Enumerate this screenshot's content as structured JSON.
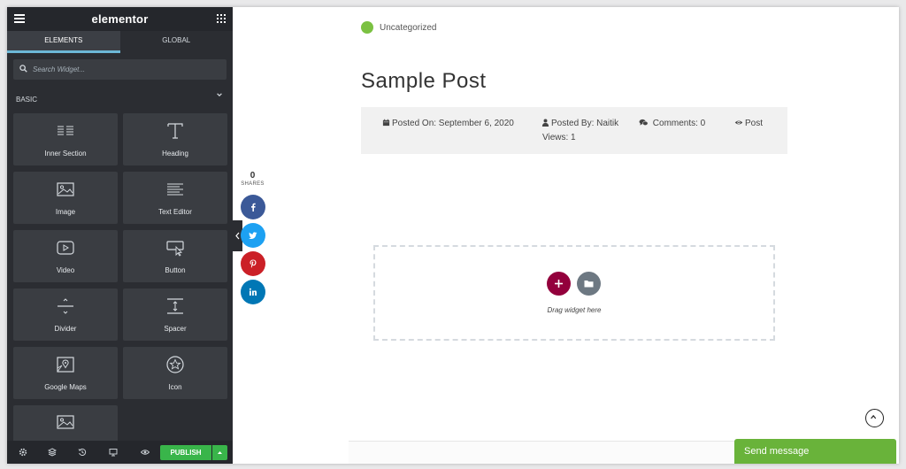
{
  "app": {
    "logo": "elementor"
  },
  "sidebar": {
    "tabs": [
      {
        "label": "ELEMENTS",
        "active": true
      },
      {
        "label": "GLOBAL",
        "active": false
      }
    ],
    "search": {
      "placeholder": "Search Widget..."
    },
    "section": {
      "label": "BASIC",
      "expanded": true
    },
    "widgets": [
      {
        "label": "Inner Section",
        "icon": "inner-section-icon"
      },
      {
        "label": "Heading",
        "icon": "heading-icon"
      },
      {
        "label": "Image",
        "icon": "image-icon"
      },
      {
        "label": "Text Editor",
        "icon": "text-editor-icon"
      },
      {
        "label": "Video",
        "icon": "video-icon"
      },
      {
        "label": "Button",
        "icon": "button-icon"
      },
      {
        "label": "Divider",
        "icon": "divider-icon"
      },
      {
        "label": "Spacer",
        "icon": "spacer-icon"
      },
      {
        "label": "Google Maps",
        "icon": "google-maps-icon"
      },
      {
        "label": "Icon",
        "icon": "star-icon"
      },
      {
        "label": "",
        "icon": "image-box-icon"
      }
    ],
    "footer": {
      "publish_label": "PUBLISH"
    }
  },
  "share": {
    "count": "0",
    "label": "SHARES",
    "buttons": [
      {
        "name": "facebook",
        "color": "#3b5998"
      },
      {
        "name": "twitter",
        "color": "#1da1f2"
      },
      {
        "name": "pinterest",
        "color": "#cb2027"
      },
      {
        "name": "linkedin",
        "color": "#0077b5"
      }
    ]
  },
  "post": {
    "category": "Uncategorized",
    "title": "Sample Post",
    "meta": {
      "posted_on": "Posted On: September 6, 2020",
      "posted_by": "Posted By: Naitik",
      "comments": "Comments: 0",
      "views_line1": "Post",
      "views_line2": "Views: 1"
    }
  },
  "editor": {
    "drag_text": "Drag widget here"
  },
  "chat": {
    "label": "Send message"
  },
  "colors": {
    "accent": "#6cb7d6",
    "publish": "#39b54a",
    "add_button": "#93003c",
    "category_dot": "#7bc142",
    "chat": "#69b33a"
  }
}
